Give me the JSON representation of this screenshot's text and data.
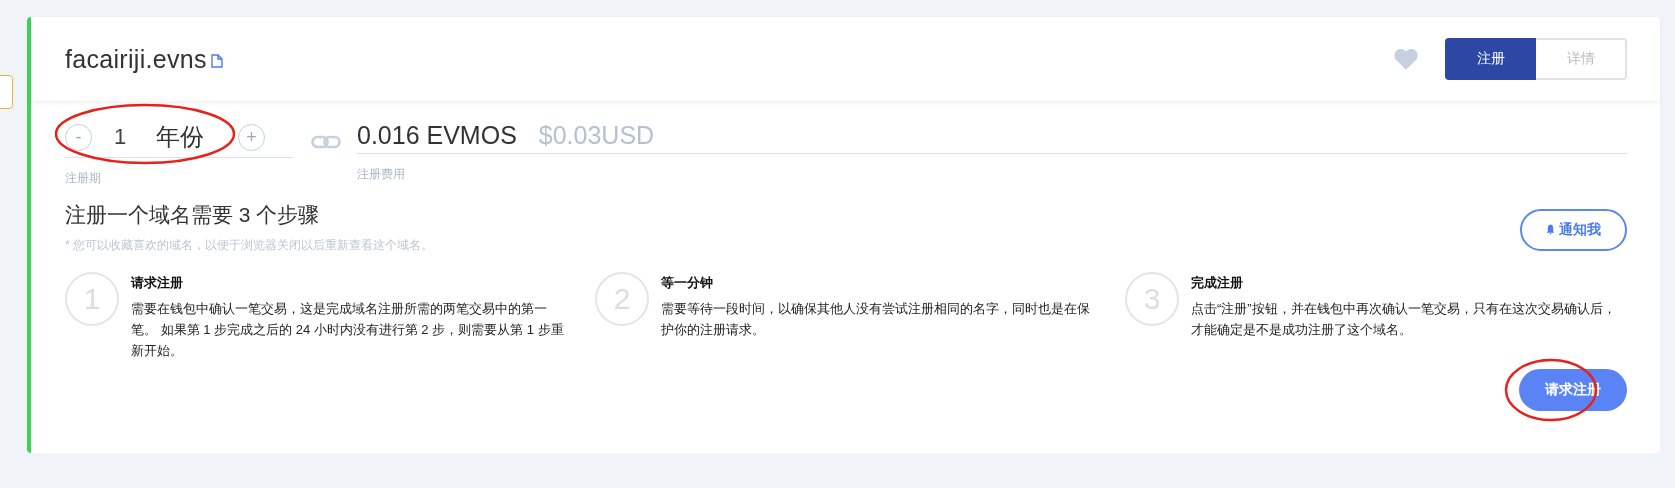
{
  "domain": {
    "name": "facairiji.evns"
  },
  "favorite": {
    "on": false
  },
  "tabs": [
    {
      "label": "注册",
      "selected": true
    },
    {
      "label": "详情",
      "selected": false
    }
  ],
  "period": {
    "minus": "-",
    "value": "1",
    "unit": "年份",
    "plus": "+",
    "label": "注册期",
    "circled": true
  },
  "price": {
    "amount": "0.016 EVMOS",
    "usd": "$0.03USD",
    "label": "注册费用"
  },
  "heading": "注册一个域名需要 3 个步骤",
  "note": "* 您可以收藏喜欢的域名，以便于浏览器关闭以后重新查看这个域名。",
  "notify_button": {
    "label": "通知我"
  },
  "steps": [
    {
      "number": "1",
      "title": "请求注册",
      "text": "需要在钱包中确认一笔交易，这是完成域名注册所需的两笔交易中的第一笔。 如果第 1 步完成之后的 24 小时内没有进行第 2 步，则需要从第 1 步重新开始。"
    },
    {
      "number": "2",
      "title": "等一分钟",
      "text": "需要等待一段时间，以确保其他人没有尝试注册相同的名字，同时也是在保护你的注册请求。"
    },
    {
      "number": "3",
      "title": "完成注册",
      "text": "点击“注册”按钮，并在钱包中再次确认一笔交易，只有在这次交易确认后，才能确定是不是成功注册了这个域名。"
    }
  ],
  "request_button": {
    "label": "请求注册",
    "circled": true
  }
}
